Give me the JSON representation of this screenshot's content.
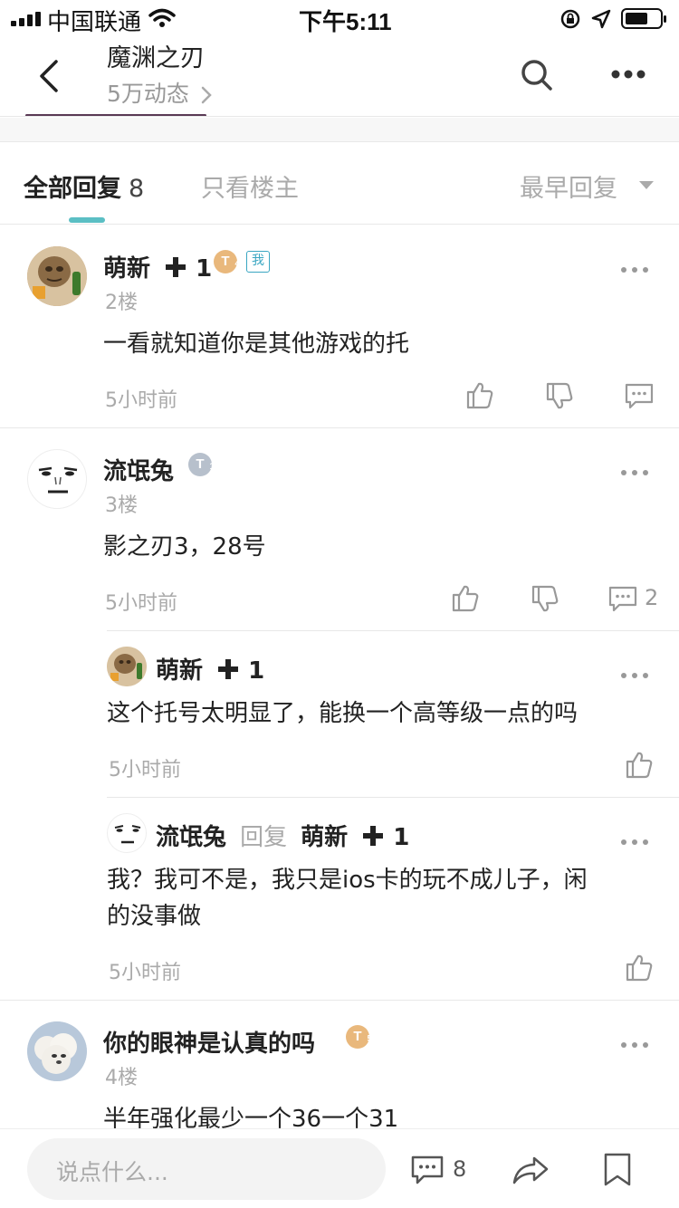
{
  "status_bar": {
    "carrier": "中国联通",
    "time": "下午5:11"
  },
  "nav": {
    "title": "魔渊之刃",
    "subtitle": "5万动态"
  },
  "tabs": {
    "all_label": "全部回复",
    "all_count": "8",
    "owner_label": "只看楼主",
    "sort_label": "最早回复"
  },
  "comments": [
    {
      "user": "萌新",
      "user_suffix": "1",
      "floor": "2楼",
      "text": "一看就知道你是其他游戏的托",
      "time": "5小时前",
      "badge_level": "4",
      "me_badge": "我"
    },
    {
      "user": "流氓兔",
      "floor": "3楼",
      "text": "影之刃3，28号",
      "time": "5小时前",
      "badge_level": "1",
      "reply_count": "2",
      "replies": [
        {
          "user": "萌新",
          "user_suffix": "1",
          "text": "这个托号太明显了，能换一个高等级一点的吗",
          "time": "5小时前"
        },
        {
          "user": "流氓兔",
          "reply_word": "回复",
          "reply_to": "萌新",
          "reply_to_suffix": "1",
          "text_line1": "我？我可不是，我只是ios卡的玩不成儿子，闲",
          "text_line2": "的没事做",
          "time": "5小时前"
        }
      ]
    },
    {
      "user": "你的眼神是认真的吗",
      "floor": "4楼",
      "text": "半年强化最少一个36一个31",
      "badge_level": "5"
    }
  ],
  "bottom_bar": {
    "input_placeholder": "说点什么...",
    "comment_count": "8"
  },
  "colors": {
    "accent": "#5bbfc4",
    "badge_gold": "#e9b87c",
    "badge_silver": "#b7c0cc",
    "me_badge": "#3aa6c2"
  }
}
